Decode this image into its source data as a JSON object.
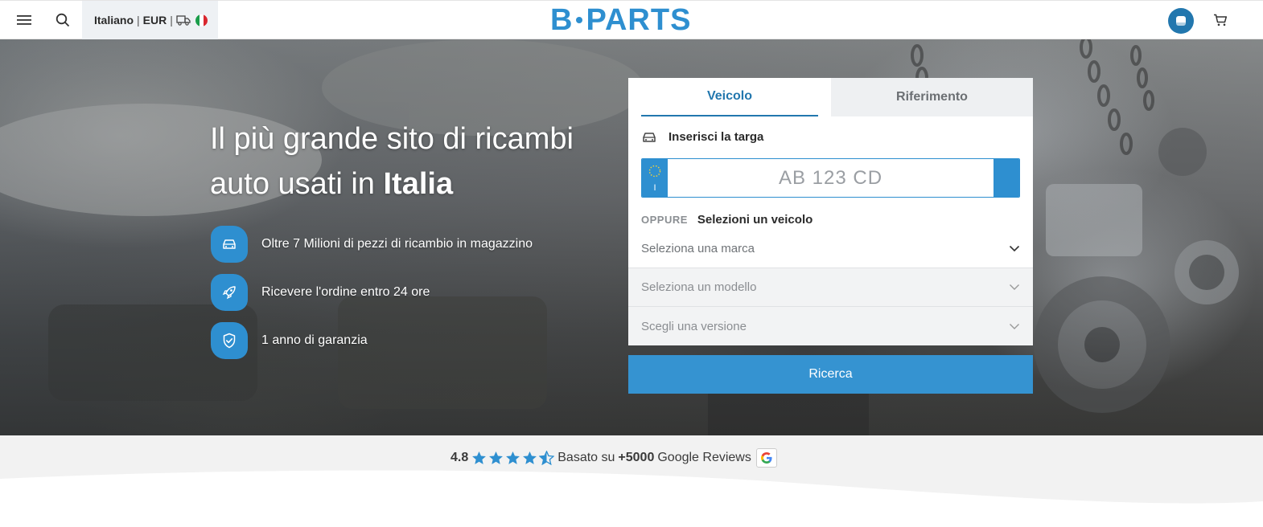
{
  "header": {
    "locale": {
      "language": "Italiano",
      "currency": "EUR",
      "separator": "|"
    },
    "logo": {
      "left": "B",
      "right": "PARTS"
    },
    "icons": [
      "menu-icon",
      "search-icon",
      "truck-icon",
      "italy-flag-icon",
      "account-icon",
      "cart-icon"
    ]
  },
  "hero": {
    "title_line1": "Il più grande sito di ricambi",
    "title_line2_prefix": "auto usati in ",
    "title_line2_bold": "Italia",
    "features": [
      {
        "icon": "car-icon",
        "text": "Oltre 7 Milioni di pezzi di ricambio in magazzino"
      },
      {
        "icon": "rocket-icon",
        "text": "Ricevere l'ordine entro 24 ore"
      },
      {
        "icon": "shield-check-icon",
        "text": "1 anno di garanzia"
      }
    ]
  },
  "search_panel": {
    "tabs": {
      "vehicle": "Veicolo",
      "reference": "Riferimento"
    },
    "active_tab": "Veicolo",
    "plate_label": "Inserisci la targa",
    "plate": {
      "placeholder": "AB 123 CD",
      "country_code": "I"
    },
    "oppure": "OPPURE",
    "select_vehicle": "Selezioni un veicolo",
    "selects": {
      "make": "Seleziona una marca",
      "model": "Seleziona un modello",
      "version": "Scegli una versione"
    },
    "submit": "Ricerca"
  },
  "reviews": {
    "score": "4.8",
    "stars": 4.5,
    "based_on": "Basato su",
    "count": "+5000",
    "source": "Google Reviews"
  },
  "colors": {
    "brand_blue": "#2e8fd0",
    "dark_blue": "#2277ae",
    "button_blue": "#3593d1"
  }
}
